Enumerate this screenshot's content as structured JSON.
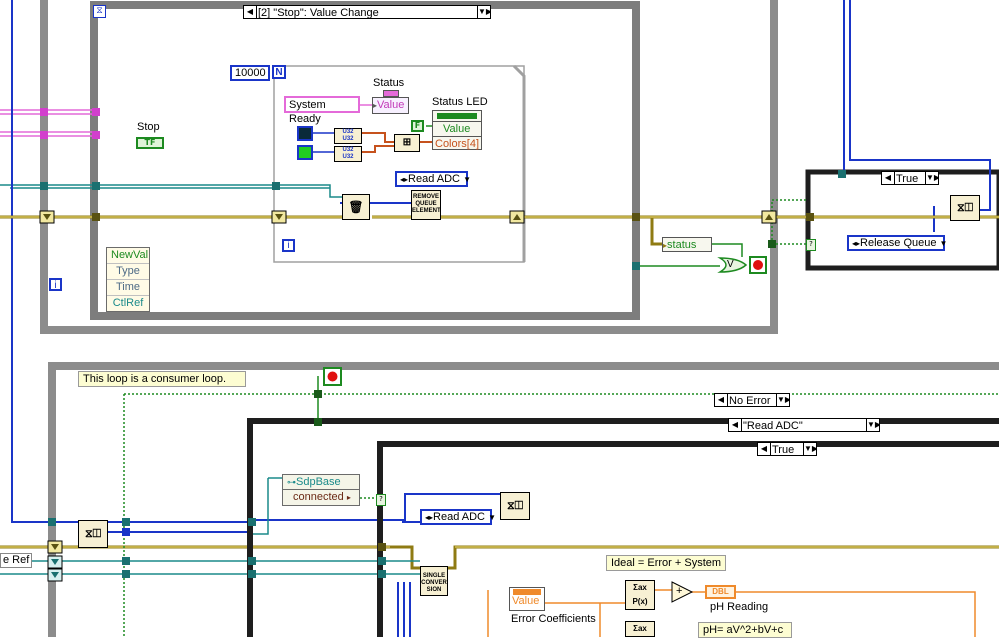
{
  "event_structure": {
    "case_selector": "[2] \"Stop\": Value Change",
    "index_icon": "i"
  },
  "outer_loop_index": "i",
  "inner_loop": {
    "count": "10000",
    "count_terminal": "N",
    "index_icon": "i"
  },
  "labels": {
    "stop": "Stop",
    "stop_control": "TF",
    "status": "Status",
    "status_value": "Value",
    "status_led": "Status LED",
    "led_value": "Value",
    "led_colors": "Colors[4]",
    "false_const": "F",
    "u32": "U32",
    "ph_reading": "pH Reading",
    "error_coefficients": "Error Coefficients",
    "coef_value": "Value",
    "status_unbundle": "status",
    "or_symbol": "V",
    "ref_label": "e Ref"
  },
  "constants": {
    "system_ready": "System Ready",
    "read_adc_enum_top": "Read ADC",
    "read_adc_enum_bottom": "Read ADC",
    "release_queue": "Release Queue"
  },
  "nodes": {
    "remove_queue_element": "REMOVE QUEUE ELEMENT",
    "single_conversion": "SINGLE CONVER SION",
    "dbl": "DBL",
    "poly": "P(x)",
    "add": "+"
  },
  "event_data_node": [
    "NewVal",
    "Type",
    "Time",
    "CtlRef"
  ],
  "case_true_top": "True",
  "comments": {
    "consumer": "This loop is a consumer loop.",
    "ideal": "Ideal = Error + System",
    "ph_formula": "pH= aV^2+bV+c"
  },
  "case_no_error": "No Error",
  "case_read_adc": "\"Read ADC\"",
  "case_true_inner": "True",
  "property_node": {
    "class": "SdpBase",
    "property": "connected"
  },
  "colors": {
    "loop_border": "#8c8c8c",
    "case_border": "#1e1e1e",
    "error_wire": "#8f7b13",
    "string_wire": "#e46ad9",
    "enum_wire": "#1a35c8",
    "refnum_wire": "#1a8a8a",
    "bool_wire": "#1d8a20",
    "dbl_wire": "#ef8a2b"
  }
}
